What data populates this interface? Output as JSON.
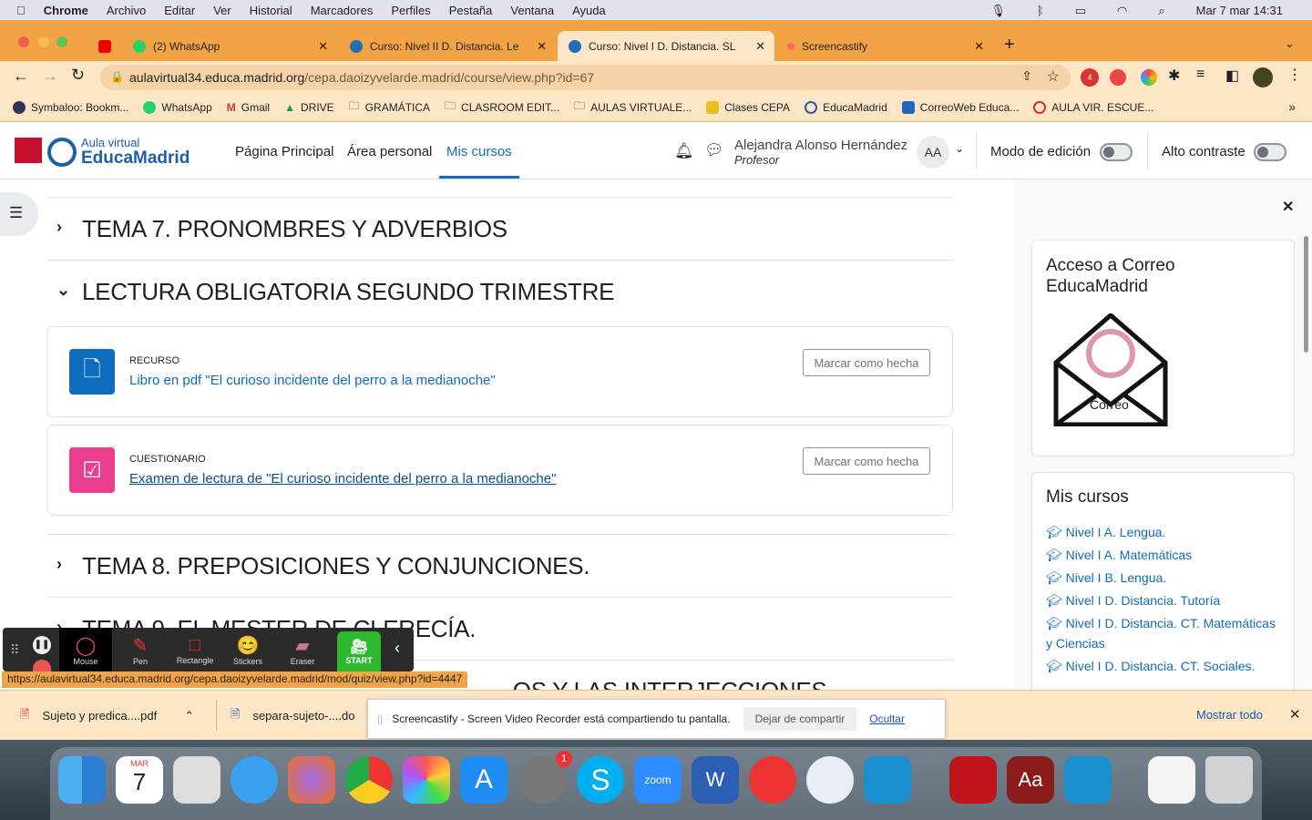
{
  "menubar": {
    "app": "Chrome",
    "items": [
      "Archivo",
      "Editar",
      "Ver",
      "Historial",
      "Marcadores",
      "Perfiles",
      "Pestaña",
      "Ventana",
      "Ayuda"
    ],
    "datetime": "Mar 7 mar  14:31"
  },
  "tabs": [
    {
      "label": "(2) WhatsApp",
      "active": false
    },
    {
      "label": "Curso: Nivel II D. Distancia. Le",
      "active": false
    },
    {
      "label": "Curso: Nivel I D. Distancia. SL",
      "active": true
    },
    {
      "label": "Screencastify",
      "active": false
    }
  ],
  "address": {
    "domain": "aulavirtual34.educa.madrid.org",
    "path": "/cepa.daoizyvelarde.madrid/course/view.php?id=67",
    "badge": "4"
  },
  "bookmarks": [
    "Symbaloo: Bookm...",
    "WhatsApp",
    "Gmail",
    "DRIVE",
    "GRAMÁTICA",
    "CLASROOM EDIT...",
    "AULAS VIRTUALE...",
    "Clases CEPA",
    "EducaMadrid",
    "CorreoWeb Educa...",
    "AULA VIR. ESCUE..."
  ],
  "bookmarks_more": "»",
  "site": {
    "logo_top": "Aula virtual",
    "logo_bottom": "EducaMadrid",
    "nav": [
      "Página Principal",
      "Área personal",
      "Mis cursos"
    ],
    "active_nav": "Mis cursos",
    "user_name": "Alejandra Alonso Hernández",
    "user_role": "Profesor",
    "user_initials": "AA",
    "edit_mode_label": "Modo de edición",
    "high_contrast_label": "Alto contraste"
  },
  "sections": [
    {
      "title": "TEMA 7. PRONOMBRES Y ADVERBIOS",
      "expanded": false
    },
    {
      "title": "LECTURA OBLIGATORIA SEGUNDO TRIMESTRE",
      "expanded": true
    },
    {
      "title": "TEMA 8. PREPOSICIONES Y CONJUNCIONES.",
      "expanded": false
    },
    {
      "title": "TEMA 9. EL MESTER DE CLERECÍA.",
      "expanded": false
    },
    {
      "title": "...OS Y LAS INTERJECCIONES",
      "expanded": false
    }
  ],
  "activities": [
    {
      "type": "RECURSO",
      "name": "Libro en pdf \"El curioso incidente del perro a la medianoche\"",
      "button": "Marcar como hecha",
      "color": "#0f6cbf"
    },
    {
      "type": "CUESTIONARIO",
      "name": "Examen de lectura de \"El curioso incidente del perro a la medianoche\"",
      "button": "Marcar como hecha",
      "color": "#e83e8c"
    }
  ],
  "drawer": {
    "mail_block_title": "Acceso a Correo EducaMadrid",
    "mail_logo_text": "Correo",
    "courses_title": "Mis cursos",
    "courses": [
      "Nivel I A. Lengua.",
      "Nivel I A. Matemáticas",
      "Nivel I B. Lengua.",
      "Nivel I D. Distancia. Tutoría",
      "Nivel I D. Distancia. CT. Matemáticas y Ciencias",
      "Nivel I D. Distancia. CT. Sociales."
    ]
  },
  "screencastify_toolbar": {
    "tools": [
      "Mouse",
      "Pen",
      "Rectangle",
      "Stickers",
      "Eraser"
    ],
    "start": "START"
  },
  "status_url": "https://aulavirtual34.educa.madrid.org/cepa.daoizyvelarde.madrid/mod/quiz/view.php?id=4447",
  "downloads": {
    "items": [
      "Sujeto y predica....pdf",
      "separa-sujeto-....do"
    ],
    "show_all": "Mostrar todo"
  },
  "share_bar": {
    "message": "Screencastify - Screen Video Recorder está compartiendo tu pantalla.",
    "stop": "Dejar de compartir",
    "hide": "Ocultar"
  },
  "dock": {
    "calendar_month": "MAR",
    "calendar_day": "7",
    "settings_badge": "1",
    "zoom_label": "zoom"
  }
}
